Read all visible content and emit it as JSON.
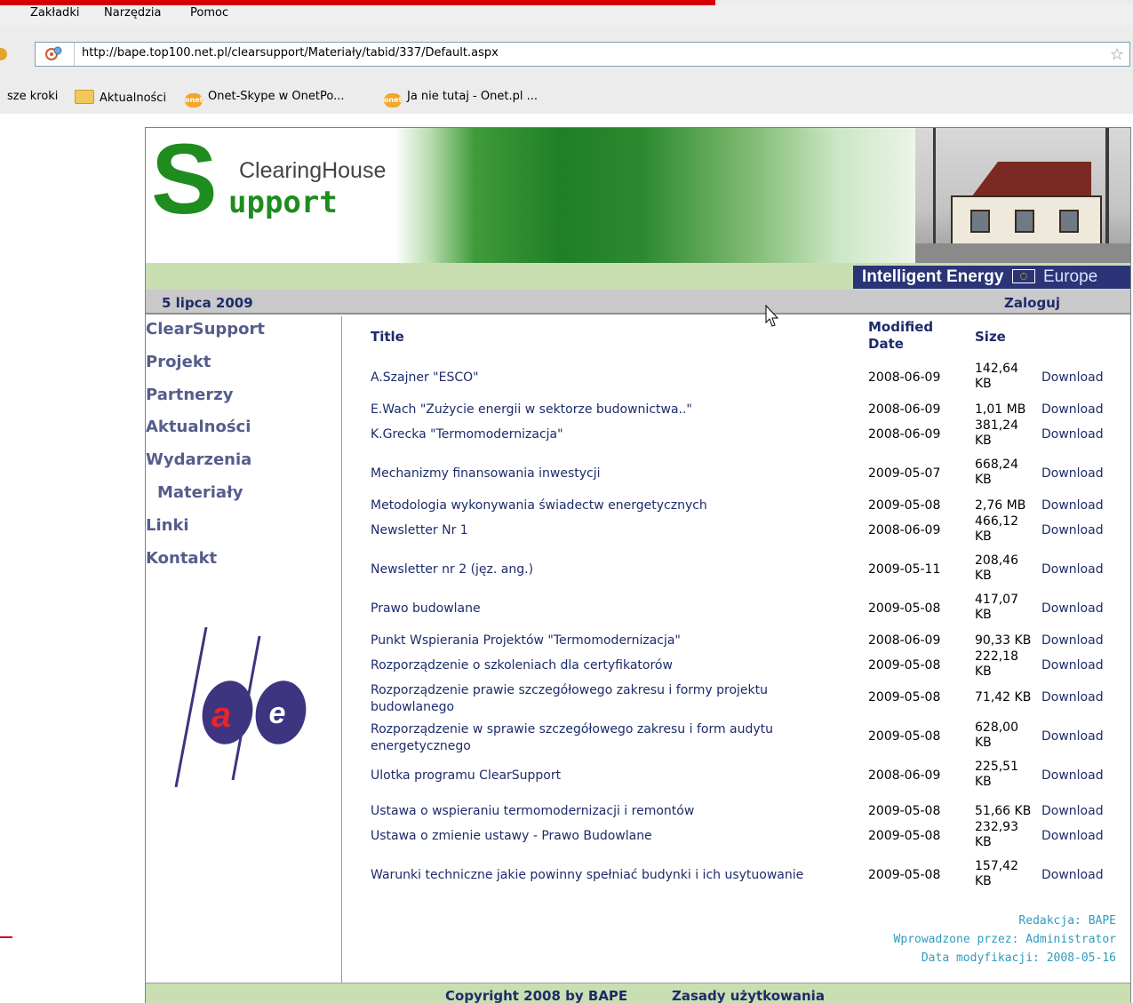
{
  "browser": {
    "menu": [
      "Zakładki",
      "Narzędzia",
      "Pomoc"
    ],
    "url": "http://bape.top100.net.pl/clearsupport/Materiały/tabid/337/Default.aspx",
    "bookmarks": [
      {
        "label": "sze kroki",
        "icon": ""
      },
      {
        "label": "Aktualności",
        "icon": "folder-icon"
      },
      {
        "label": "Onet-Skype w OnetPo...",
        "icon": "onet-icon"
      },
      {
        "label": "Ja nie tutaj - Onet.pl ...",
        "icon": "onet-icon"
      }
    ],
    "onet_badge": "onet"
  },
  "site": {
    "logo": {
      "s": "S",
      "clearinghouse": "ClearingHouse",
      "upport": "upport"
    },
    "energy": {
      "intelligent": "Intelligent Energy",
      "europe": "Europe"
    },
    "date": "5 lipca 2009",
    "login": "Zaloguj",
    "nav": [
      "ClearSupport",
      "Projekt",
      "Partnerzy",
      "Aktualności",
      "Wydarzenia",
      "Materiały",
      "Linki",
      "Kontakt"
    ],
    "nav_active": "Materiały",
    "table": {
      "headers": {
        "title": "Title",
        "modified": "Modified Date",
        "size": "Size"
      },
      "rows": [
        {
          "title": "A.Szajner \"ESCO\"",
          "date": "2008-06-09",
          "size": "142,64 KB",
          "download": "Download"
        },
        {
          "title": "E.Wach \"Zużycie energii w sektorze budownictwa..\"",
          "date": "2008-06-09",
          "size": "1,01 MB",
          "download": "Download"
        },
        {
          "title": "K.Grecka \"Termomodernizacja\"",
          "date": "2008-06-09",
          "size": "381,24 KB",
          "download": "Download"
        },
        {
          "title": "Mechanizmy finansowania inwestycji",
          "date": "2009-05-07",
          "size": "668,24 KB",
          "download": "Download"
        },
        {
          "title": "Metodologia wykonywania świadectw energetycznych",
          "date": "2009-05-08",
          "size": "2,76 MB",
          "download": "Download"
        },
        {
          "title": "Newsletter Nr 1",
          "date": "2008-06-09",
          "size": "466,12 KB",
          "download": "Download"
        },
        {
          "title": "Newsletter nr 2 (jęz. ang.)",
          "date": "2009-05-11",
          "size": "208,46 KB",
          "download": "Download"
        },
        {
          "title": "Prawo budowlane",
          "date": "2009-05-08",
          "size": "417,07 KB",
          "download": "Download"
        },
        {
          "title": "Punkt Wspierania Projektów \"Termomodernizacja\"",
          "date": "2008-06-09",
          "size": "90,33 KB",
          "download": "Download"
        },
        {
          "title": "Rozporządzenie o szkoleniach dla certyfikatorów",
          "date": "2009-05-08",
          "size": "222,18 KB",
          "download": "Download"
        },
        {
          "title": "Rozporządzenie prawie szczegółowego zakresu i formy projektu budowlanego",
          "date": "2009-05-08",
          "size": "71,42 KB",
          "download": "Download"
        },
        {
          "title": "Rozporządzenie w sprawie szczegółowego zakresu i form audytu energetycznego",
          "date": "2009-05-08",
          "size": "628,00 KB",
          "download": "Download"
        },
        {
          "title": "Ulotka programu ClearSupport",
          "date": "2008-06-09",
          "size": "225,51 KB",
          "download": "Download"
        },
        {
          "title": "Ustawa o wspieraniu termomodernizacji i remontów",
          "date": "2009-05-08",
          "size": "51,66 KB",
          "download": "Download"
        },
        {
          "title": "Ustawa o zmienie ustawy - Prawo Budowlane",
          "date": "2009-05-08",
          "size": "232,93 KB",
          "download": "Download"
        },
        {
          "title": "Warunki techniczne jakie powinny spełniać budynki i ich usytuowanie",
          "date": "2009-05-08",
          "size": "157,42 KB",
          "download": "Download"
        }
      ]
    },
    "footer_info": [
      "Redakcja: BAPE",
      "Wprowadzone przez: Administrator",
      "Data modyfikacji: 2008-05-16"
    ],
    "copyright": "Copyright 2008 by BAPE",
    "terms": "Zasady użytkowania",
    "bape_letters": {
      "a": "a",
      "e": "e"
    }
  },
  "colors": {
    "brand_green": "#1e8c1e",
    "nav_text": "#555d8c",
    "link": "#1d2b6b",
    "energy_bg": "#2a3476",
    "bar_green": "#c9dfb2",
    "info_text": "#2f9bbf"
  }
}
